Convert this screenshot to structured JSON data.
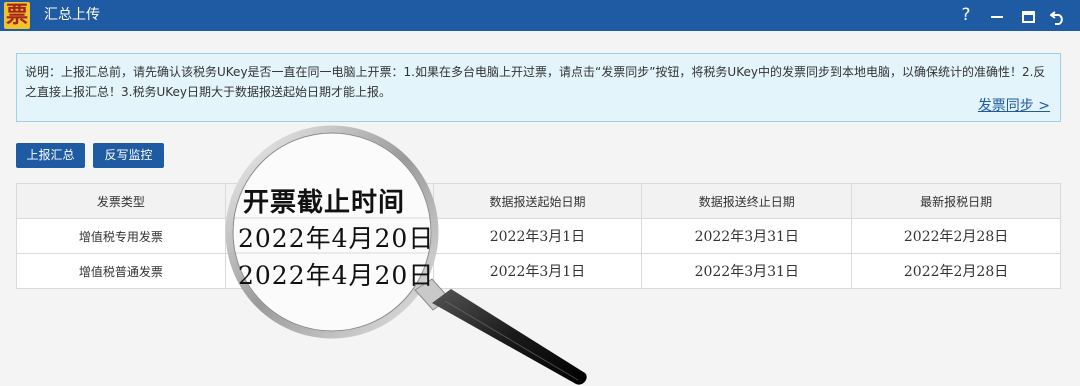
{
  "window": {
    "logo_char": "票",
    "title": "汇总上传",
    "help_label": "?"
  },
  "notice": {
    "text": "说明：上报汇总前，请先确认该税务UKey是否一直在同一电脑上开票：1.如果在多台电脑上开过票，请点击“发票同步”按钮，将税务UKey中的发票同步到本地电脑，以确保统计的准确性！2.反之直接上报汇总！3.税务UKey日期大于数据报送起始日期才能上报。",
    "link_label": "发票同步 >"
  },
  "toolbar": {
    "summary_label": "上报汇总",
    "monitor_label": "反写监控"
  },
  "table": {
    "headers": [
      "发票类型",
      "开票截止时间",
      "数据报送起始日期",
      "数据报送终止日期",
      "最新报税日期"
    ],
    "rows": [
      {
        "type": "增值税专用发票",
        "deadline": "2022年4月20日",
        "start": "2022年3月1日",
        "end": "2022年3月31日",
        "latest": "2022年2月28日"
      },
      {
        "type": "增值税普通发票",
        "deadline": "2022年4月20日",
        "start": "2022年3月1日",
        "end": "2022年3月31日",
        "latest": "2022年2月28日"
      }
    ]
  }
}
